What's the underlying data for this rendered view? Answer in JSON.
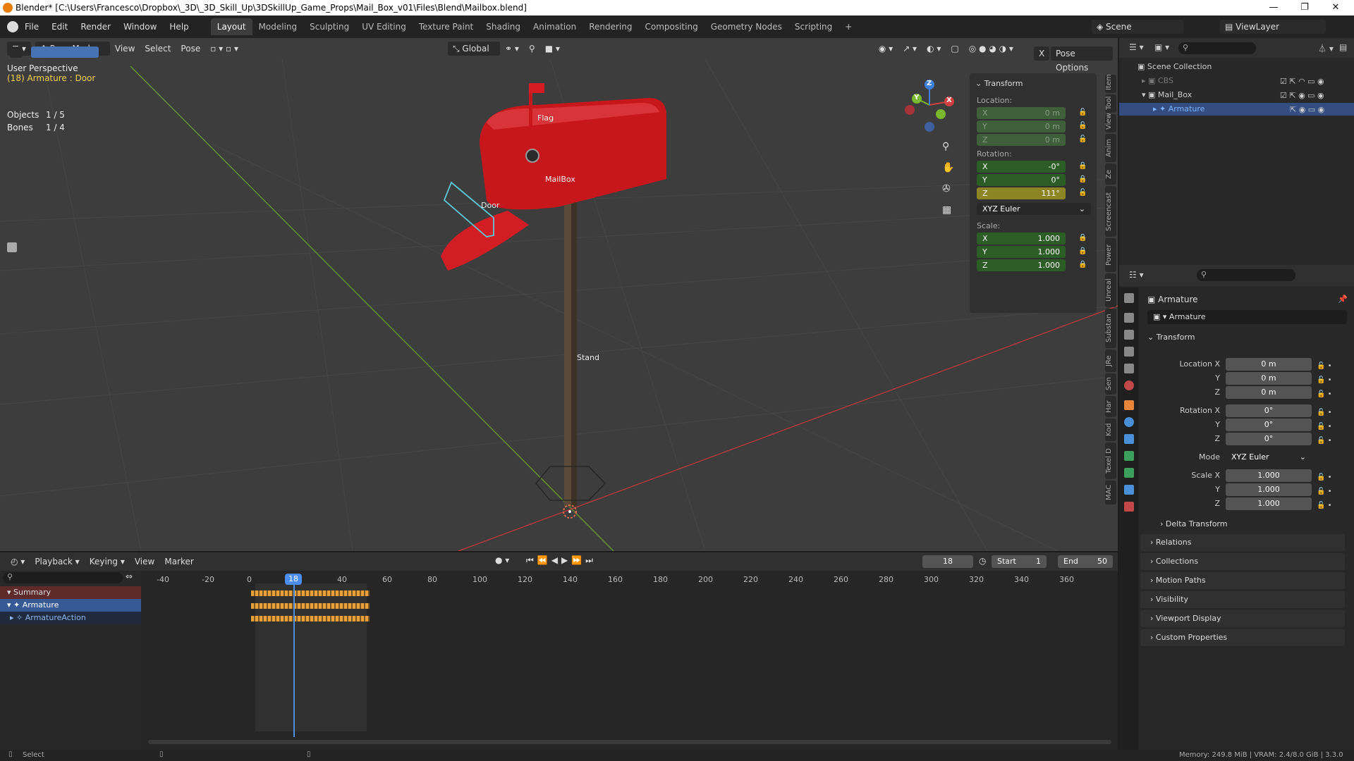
{
  "window": {
    "title": "Blender* [C:\\Users\\Francesco\\Dropbox\\_3D\\_3D_Skill_Up\\3DSkillUp_Game_Props\\Mail_Box_v01\\Files\\Blend\\Mailbox.blend]",
    "minimize": "—",
    "maximize": "❐",
    "close": "✕"
  },
  "menu": [
    "File",
    "Edit",
    "Render",
    "Window",
    "Help"
  ],
  "workspaces": [
    "Layout",
    "Modeling",
    "Sculpting",
    "UV Editing",
    "Texture Paint",
    "Shading",
    "Animation",
    "Rendering",
    "Compositing",
    "Geometry Nodes",
    "Scripting"
  ],
  "workspace_add": "+",
  "scene": {
    "label": "Scene",
    "viewlayer": "ViewLayer"
  },
  "viewport": {
    "mode": "Pose Mode",
    "menus": [
      "View",
      "Select",
      "Pose"
    ],
    "orientation": "Global",
    "pose_options": "Pose Options",
    "x_toggle": "X",
    "overlay_title": "User Perspective",
    "overlay_sub": "(18) Armature : Door",
    "stats": [
      {
        "label": "Objects",
        "value": "1 / 5"
      },
      {
        "label": "Bones",
        "value": "1 / 4"
      }
    ],
    "bone_labels": {
      "flag": "Flag",
      "mailbox": "MailBox",
      "door": "Door",
      "stand": "Stand"
    },
    "gizmo": {
      "x": "X",
      "y": "Y",
      "z": "Z"
    },
    "colors": {
      "background": "#3d3d3d",
      "mailbox": "#c8161d",
      "x_axis": "#c0383c",
      "y_axis": "#6a9a2a",
      "selected_bone": "#5cc8d8"
    }
  },
  "npanel": {
    "title": "Transform",
    "location_label": "Location:",
    "location": [
      {
        "axis": "X",
        "value": "0 m"
      },
      {
        "axis": "Y",
        "value": "0 m"
      },
      {
        "axis": "Z",
        "value": "0 m"
      }
    ],
    "rotation_label": "Rotation:",
    "rotation": [
      {
        "axis": "X",
        "value": "-0°"
      },
      {
        "axis": "Y",
        "value": "0°"
      },
      {
        "axis": "Z",
        "value": "111°"
      }
    ],
    "rotation_mode": "XYZ Euler",
    "scale_label": "Scale:",
    "scale": [
      {
        "axis": "X",
        "value": "1.000"
      },
      {
        "axis": "Y",
        "value": "1.000"
      },
      {
        "axis": "Z",
        "value": "1.000"
      }
    ],
    "tabs": [
      "Item",
      "Tool",
      "View",
      "Anim",
      "Ze",
      "Screencast",
      "Power",
      "Unreal",
      "Substan",
      "JRe",
      "Sen",
      "Har",
      "Kod",
      "Texel D",
      "MAC"
    ]
  },
  "outliner": {
    "root": "Scene Collection",
    "rows": [
      {
        "name": "CBS",
        "dim": true
      },
      {
        "name": "Mail_Box",
        "dim": false
      },
      {
        "name": "Armature",
        "selected": true
      }
    ]
  },
  "properties": {
    "object_name": "Armature",
    "datablock": "Armature",
    "transform_title": "Transform",
    "fields": [
      {
        "label": "Location X",
        "value": "0 m"
      },
      {
        "label": "Y",
        "value": "0 m"
      },
      {
        "label": "Z",
        "value": "0 m"
      },
      {
        "label": "Rotation X",
        "value": "0°"
      },
      {
        "label": "Y",
        "value": "0°"
      },
      {
        "label": "Z",
        "value": "0°"
      },
      {
        "label": "Mode",
        "value": "XYZ Euler"
      },
      {
        "label": "Scale X",
        "value": "1.000"
      },
      {
        "label": "Y",
        "value": "1.000"
      },
      {
        "label": "Z",
        "value": "1.000"
      }
    ],
    "delta": "Delta Transform",
    "sections": [
      "Relations",
      "Collections",
      "Motion Paths",
      "Visibility",
      "Viewport Display",
      "Custom Properties"
    ]
  },
  "timeline": {
    "menus": [
      "Playback",
      "Keying",
      "View",
      "Marker"
    ],
    "current_frame": "18",
    "start_label": "Start",
    "start": "1",
    "end_label": "End",
    "end": "50",
    "ticks": [
      "-40",
      "-20",
      "0",
      "18",
      "40",
      "60",
      "80",
      "100",
      "120",
      "140",
      "160",
      "180",
      "200",
      "220",
      "240",
      "260",
      "280",
      "300",
      "320",
      "340",
      "360"
    ],
    "channels": [
      {
        "name": "Summary",
        "kind": "summary"
      },
      {
        "name": "Armature",
        "kind": "object"
      },
      {
        "name": "ArmatureAction",
        "kind": "action"
      }
    ]
  },
  "status": {
    "left": "Select",
    "right": "Memory: 249.8 MiB | VRAM: 2.4/8.0 GiB | 3.3.0"
  }
}
